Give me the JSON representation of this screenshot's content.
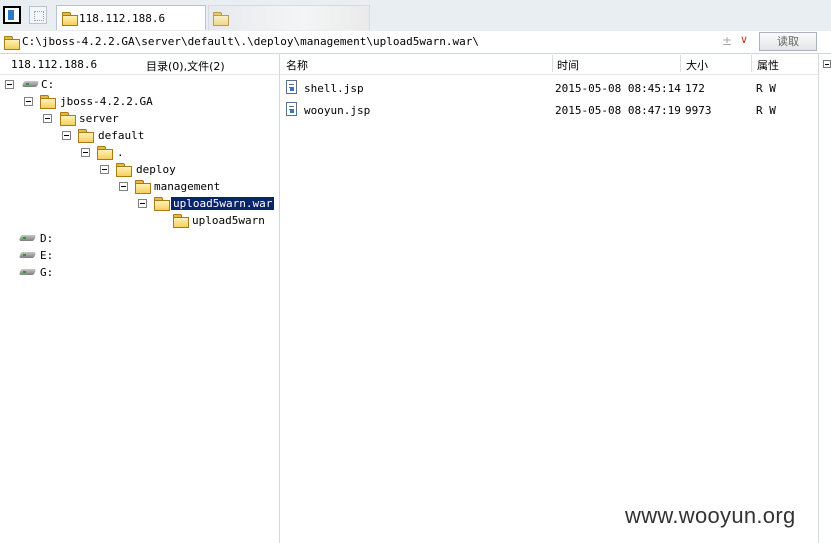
{
  "tabs": [
    {
      "label": "118.112.188.6",
      "active": true,
      "icon": "folder-icon"
    },
    {
      "label": "",
      "active": false,
      "icon": "folder-icon"
    }
  ],
  "address": {
    "path": "C:\\jboss-4.2.2.GA\\server\\default\\.\\deploy\\management\\upload5warn.war\\",
    "plus": "±",
    "dropdown": "∨",
    "read_button": "读取"
  },
  "left_pane": {
    "host": "118.112.188.6",
    "summary": "目录(0),文件(2)"
  },
  "tree": {
    "drive_c": "C:",
    "jboss": "jboss-4.2.2.GA",
    "server": "server",
    "default": "default",
    "dot": ".",
    "deploy": "deploy",
    "management": "management",
    "upload_war": "upload5warn.war",
    "upload_dir": "upload5warn",
    "drive_d": "D:",
    "drive_e": "E:",
    "drive_g": "G:"
  },
  "file_list": {
    "columns": {
      "name": "名称",
      "time": "时间",
      "size": "大小",
      "attr": "属性"
    },
    "rows": [
      {
        "name": "shell.jsp",
        "time": "2015-05-08 08:45:14",
        "size": "172",
        "attr": "R W"
      },
      {
        "name": "wooyun.jsp",
        "time": "2015-05-08 08:47:19",
        "size": "9973",
        "attr": "R W"
      }
    ]
  },
  "watermark": "www.wooyun.org"
}
